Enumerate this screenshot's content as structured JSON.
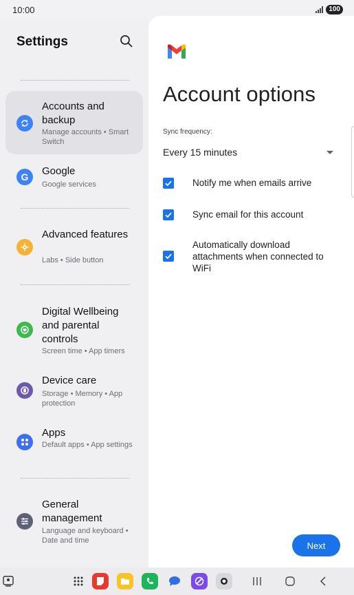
{
  "status_bar": {
    "time": "10:00",
    "battery": "100"
  },
  "settings": {
    "title": "Settings",
    "items": [
      {
        "title": "Accounts and backup",
        "subtitle": "Manage accounts • Smart Switch",
        "icon": "sync-icon",
        "color": "#3e82f7"
      },
      {
        "title": "Google",
        "subtitle": "Google services",
        "icon": "google-icon",
        "color": "#3e82f7"
      },
      {
        "title": "Advanced features",
        "subtitle": "Labs • Side button",
        "icon": "advanced-features-icon",
        "color": "#f5b236"
      },
      {
        "title": "Digital Wellbeing and parental controls",
        "subtitle": "Screen time • App timers",
        "icon": "wellbeing-icon",
        "color": "#3fb84f"
      },
      {
        "title": "Device care",
        "subtitle": "Storage • Memory • App protection",
        "icon": "device-care-icon",
        "color": "#6b5aa8"
      },
      {
        "title": "Apps",
        "subtitle": "Default apps • App settings",
        "icon": "apps-icon",
        "color": "#3e6ff0"
      },
      {
        "title": "General management",
        "subtitle": "Language and keyboard • Date and time",
        "icon": "general-management-icon",
        "color": "#5e6078"
      }
    ]
  },
  "account_options": {
    "title": "Account options",
    "sync_label": "Sync frequency:",
    "sync_value": "Every 15 minutes",
    "checkboxes": [
      {
        "label": "Notify me when emails arrive",
        "checked": true
      },
      {
        "label": "Sync email for this account",
        "checked": true
      },
      {
        "label": "Automatically download attachments when connected to WiFi",
        "checked": true
      }
    ],
    "next_label": "Next",
    "accent": "#1a73e8"
  },
  "taskbar": {
    "apps": [
      "apps-grid-icon",
      "notes-app-icon",
      "files-app-icon",
      "phone-app-icon",
      "messages-app-icon",
      "internet-app-icon",
      "camera-app-icon"
    ],
    "nav": [
      "recents-icon",
      "home-icon",
      "back-icon"
    ]
  }
}
